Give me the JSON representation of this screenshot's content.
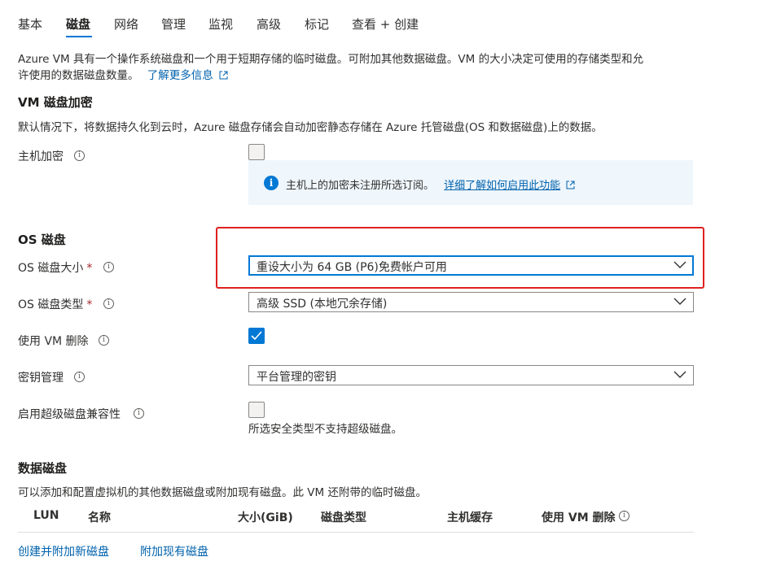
{
  "tabs": [
    {
      "label": "基本"
    },
    {
      "label": "磁盘"
    },
    {
      "label": "网络"
    },
    {
      "label": "管理"
    },
    {
      "label": "监视"
    },
    {
      "label": "高级"
    },
    {
      "label": "标记"
    },
    {
      "label": "查看 + 创建"
    }
  ],
  "intro": {
    "line1": "Azure VM 具有一个操作系统磁盘和一个用于短期存储的临时磁盘。可附加其他数据磁盘。VM 的大小决定可使用的存储类型和允",
    "line2": "许使用的数据磁盘数量。",
    "link": "了解更多信息"
  },
  "encryption": {
    "heading": "VM 磁盘加密",
    "desc": "默认情况下，将数据持久化到云时，Azure 磁盘存储会自动加密静态存储在 Azure 托管磁盘(OS 和数据磁盘)上的数据。",
    "host_label": "主机加密",
    "host_checked": false,
    "info_msg": "主机上的加密未注册所选订阅。",
    "info_link": "详细了解如何启用此功能"
  },
  "os_disk": {
    "heading": "OS 磁盘",
    "size_label": "OS 磁盘大小",
    "size_value": "重设大小为 64 GB (P6)免费帐户可用",
    "type_label": "OS 磁盘类型",
    "type_value": "高级 SSD (本地冗余存储)",
    "delete_label": "使用 VM 删除",
    "delete_checked": true,
    "key_label": "密钥管理",
    "key_value": "平台管理的密钥",
    "ultra_label": "启用超级磁盘兼容性",
    "ultra_checked": false,
    "ultra_note": "所选安全类型不支持超级磁盘。",
    "required_mark": "*"
  },
  "data_disks": {
    "heading": "数据磁盘",
    "desc": "可以添加和配置虚拟机的其他数据磁盘或附加现有磁盘。此 VM 还附带的临时磁盘。",
    "columns": [
      "LUN",
      "名称",
      "大小(GiB)",
      "磁盘类型",
      "主机缓存",
      "使用 VM 删除"
    ],
    "create_link": "创建并附加新磁盘",
    "attach_link": "附加现有磁盘"
  },
  "colors": {
    "accent": "#0078d4",
    "highlight_box": "#e02020"
  }
}
